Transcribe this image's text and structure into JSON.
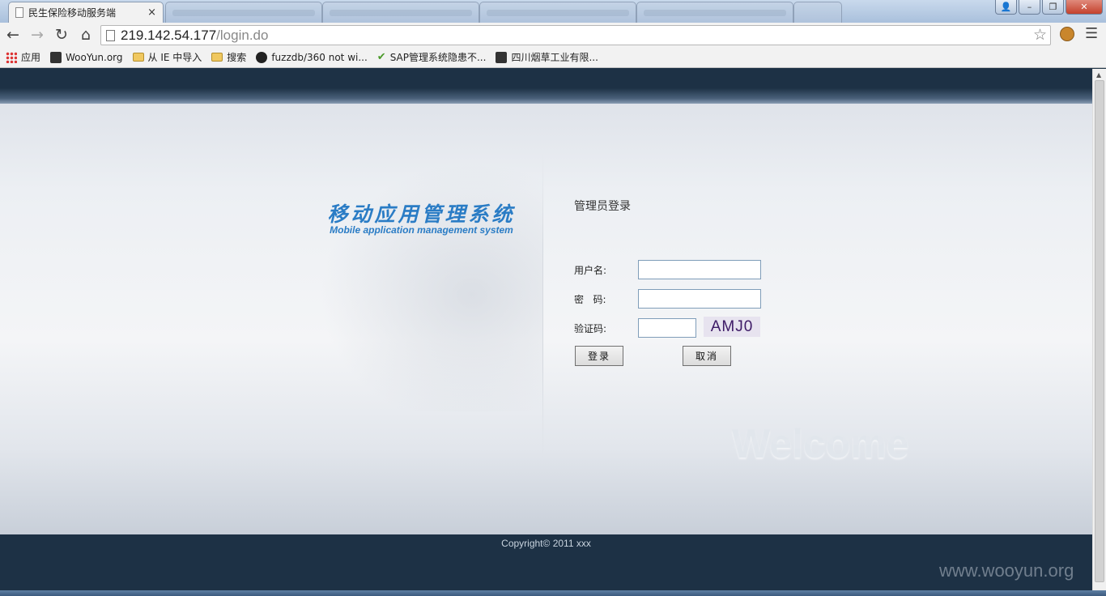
{
  "browser": {
    "active_tab_title": "民生保险移动服务端",
    "tab_close": "×",
    "window_buttons": {
      "minimize": "–",
      "maximize": "❐",
      "close": "✕"
    },
    "url_host": "219.142.54.177",
    "url_path": "/login.do",
    "bookmarks": [
      {
        "label": "应用",
        "icon": "apps-icon"
      },
      {
        "label": "WooYun.org",
        "icon": "page-icon"
      },
      {
        "label": "从 IE 中导入",
        "icon": "folder-icon"
      },
      {
        "label": "搜索",
        "icon": "folder-icon"
      },
      {
        "label": "fuzzdb/360 not wi...",
        "icon": "github-icon"
      },
      {
        "label": "SAP管理系统隐患不...",
        "icon": "check-icon"
      },
      {
        "label": "四川烟草工业有限...",
        "icon": "page-icon"
      }
    ]
  },
  "page": {
    "logo_cn": "移动应用管理系统",
    "logo_en": "Mobile application management system",
    "form_title": "管理员登录",
    "username_label": "用户名:",
    "password_label": "密   码:",
    "captcha_label": "验证码:",
    "captcha_text": "AMJ0",
    "login_button": "登录",
    "cancel_button": "取消",
    "welcome_text": "Welcome",
    "copyright": "Copyright© 2011 xxx"
  },
  "watermark": "www.wooyun.org",
  "colors": {
    "header_dark": "#1d3145",
    "logo_blue": "#2a7cc5",
    "captcha_bg": "#e7e3ef"
  }
}
